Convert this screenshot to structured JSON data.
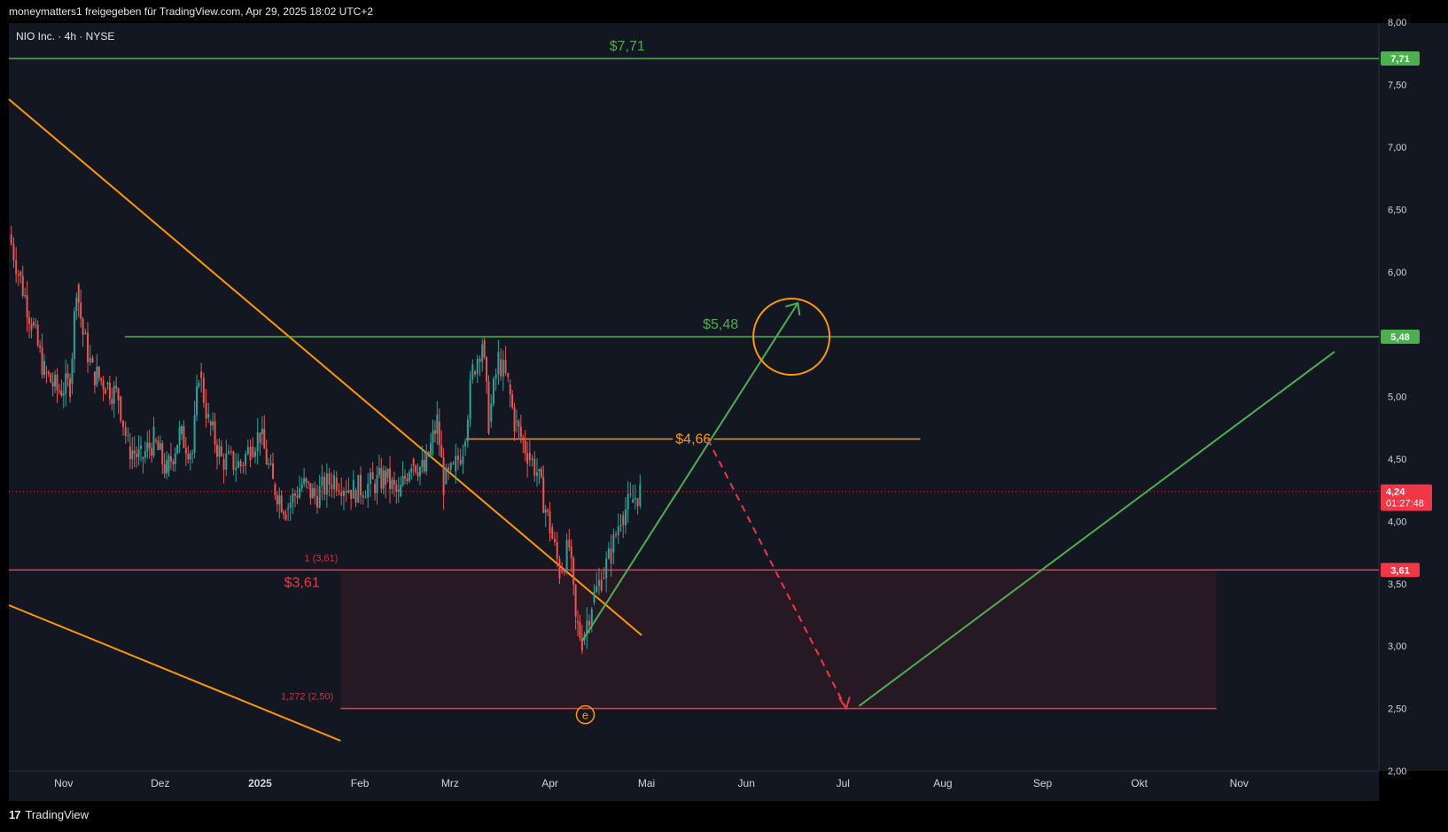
{
  "header": {
    "share_text": "moneymatters1 freigegeben für TradingView.com, Apr 29, 2025 18:02 UTC+2",
    "symbol_line": "NIO Inc. · 4h · NYSE"
  },
  "footer": {
    "brand": "TradingView",
    "logo": "tradingview-logo-icon"
  },
  "colors": {
    "background": "#131722",
    "green": "#4caf50",
    "orange": "#ff9800",
    "red": "#f23645",
    "zone_fill": "#2a1a24",
    "axis_text": "#d1d4dc"
  },
  "chart_data": {
    "type": "candlestick",
    "symbol": "NIO Inc.",
    "interval": "4h",
    "exchange": "NYSE",
    "ylim": [
      2.0,
      8.0
    ],
    "x_ticks": [
      "Nov",
      "Dez",
      "2025",
      "Feb",
      "Mrz",
      "Apr",
      "Mai",
      "Jun",
      "Jul",
      "Aug",
      "Sep",
      "Okt",
      "Nov"
    ],
    "y_ticks": [
      "2,00",
      "2,50",
      "3,00",
      "3,50",
      "4,00",
      "4,50",
      "5,00",
      "5,50",
      "6,00",
      "6,50",
      "7,00",
      "7,50",
      "8,00"
    ],
    "current_price": {
      "label": "4,24",
      "countdown": "01:27:48",
      "value": 4.24
    },
    "price_path": [
      [
        "2024-10-15",
        6.3
      ],
      [
        "2024-10-18",
        6.0
      ],
      [
        "2024-10-22",
        5.6
      ],
      [
        "2024-10-26",
        5.2
      ],
      [
        "2024-10-30",
        5.05
      ],
      [
        "2024-11-03",
        5.1
      ],
      [
        "2024-11-05",
        5.9
      ],
      [
        "2024-11-07",
        5.5
      ],
      [
        "2024-11-10",
        5.2
      ],
      [
        "2024-11-14",
        5.1
      ],
      [
        "2024-11-18",
        5.0
      ],
      [
        "2024-11-21",
        4.6
      ],
      [
        "2024-11-25",
        4.5
      ],
      [
        "2024-11-29",
        4.65
      ],
      [
        "2024-12-03",
        4.4
      ],
      [
        "2024-12-07",
        4.7
      ],
      [
        "2024-12-11",
        4.55
      ],
      [
        "2024-12-13",
        5.2
      ],
      [
        "2024-12-16",
        4.8
      ],
      [
        "2024-12-20",
        4.5
      ],
      [
        "2024-12-26",
        4.45
      ],
      [
        "2024-12-29",
        4.6
      ],
      [
        "2025-01-01",
        4.7
      ],
      [
        "2025-01-05",
        4.3
      ],
      [
        "2025-01-09",
        4.1
      ],
      [
        "2025-01-14",
        4.3
      ],
      [
        "2025-01-18",
        4.2
      ],
      [
        "2025-01-24",
        4.35
      ],
      [
        "2025-01-30",
        4.25
      ],
      [
        "2025-02-05",
        4.3
      ],
      [
        "2025-02-09",
        4.35
      ],
      [
        "2025-02-13",
        4.2
      ],
      [
        "2025-02-17",
        4.5
      ],
      [
        "2025-02-21",
        4.4
      ],
      [
        "2025-02-25",
        4.8
      ],
      [
        "2025-02-27",
        4.3
      ],
      [
        "2025-03-02",
        4.4
      ],
      [
        "2025-03-05",
        4.6
      ],
      [
        "2025-03-08",
        5.2
      ],
      [
        "2025-03-11",
        5.45
      ],
      [
        "2025-03-13",
        4.8
      ],
      [
        "2025-03-16",
        5.3
      ],
      [
        "2025-03-19",
        5.1
      ],
      [
        "2025-03-21",
        4.8
      ],
      [
        "2025-03-25",
        4.55
      ],
      [
        "2025-03-28",
        4.4
      ],
      [
        "2025-04-01",
        3.95
      ],
      [
        "2025-04-04",
        3.6
      ],
      [
        "2025-04-07",
        3.8
      ],
      [
        "2025-04-09",
        3.2
      ],
      [
        "2025-04-11",
        3.05
      ],
      [
        "2025-04-14",
        3.35
      ],
      [
        "2025-04-17",
        3.55
      ],
      [
        "2025-04-20",
        3.75
      ],
      [
        "2025-04-23",
        4.05
      ],
      [
        "2025-04-26",
        4.15
      ],
      [
        "2025-04-29",
        4.24
      ]
    ],
    "horizontal_levels": [
      {
        "price": 7.71,
        "label": "$7,71",
        "axis_label": "7,71",
        "color": "#4caf50"
      },
      {
        "price": 5.48,
        "label": "$5,48",
        "axis_label": "5,48",
        "color": "#4caf50"
      },
      {
        "price": 4.66,
        "label": "$4,66",
        "color": "#ff9800"
      },
      {
        "price": 3.61,
        "label": "$3,61",
        "axis_label": "3,61",
        "color": "#f23645"
      }
    ],
    "fib_labels": [
      {
        "text": "1 (3,61)",
        "price": 3.61
      },
      {
        "text": "1,272 (2,50)",
        "price": 2.5
      }
    ],
    "zone": {
      "from_price": 2.5,
      "to_price": 3.61,
      "color": "#f23645"
    },
    "wave_label": "e"
  }
}
